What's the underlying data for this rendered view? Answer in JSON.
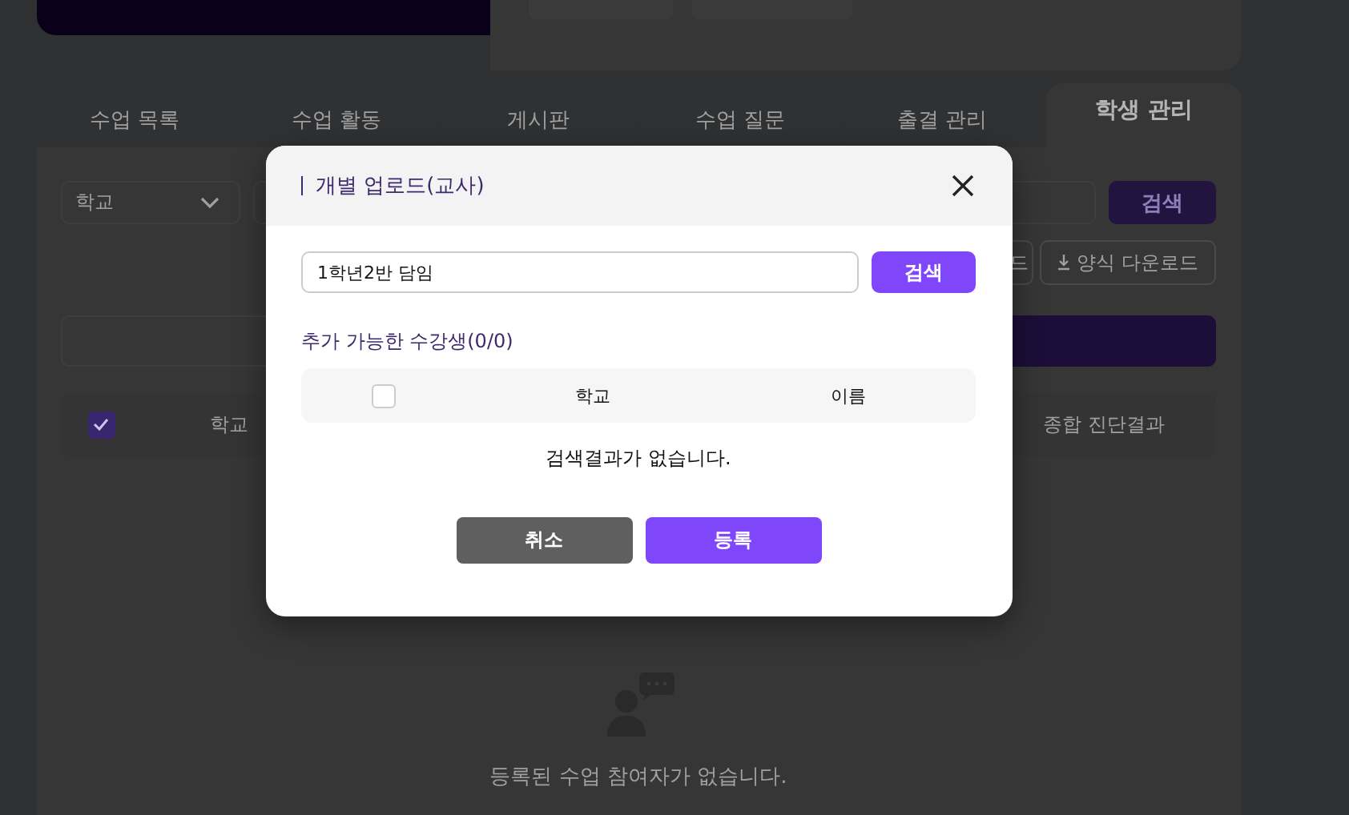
{
  "tabs": [
    {
      "label": "수업 목록",
      "selected": false
    },
    {
      "label": "수업 활동",
      "selected": false
    },
    {
      "label": "게시판",
      "selected": false
    },
    {
      "label": "수업 질문",
      "selected": false
    },
    {
      "label": "출결 관리",
      "selected": false
    },
    {
      "label": "학생 관리",
      "selected": true
    }
  ],
  "filters": {
    "school_select": "학교",
    "search_button": "검색"
  },
  "actions": [
    "드",
    "양식 다운로드"
  ],
  "table": {
    "select_all_checked": true,
    "columns": [
      "학교",
      "종합 진단결과"
    ]
  },
  "empty_message": "등록된 수업 참여자가 없습니다.",
  "dialog": {
    "title": "개별 업로드(교사)",
    "search": {
      "value": "1학년2반 담임",
      "button": "검색"
    },
    "list_label": "추가 가능한 수강생(0/0)",
    "table": {
      "select_all_checked": false,
      "columns": [
        "학교",
        "이름"
      ]
    },
    "empty_message": "검색결과가 없습니다.",
    "buttons": [
      {
        "label": "취소",
        "kind": "secondary"
      },
      {
        "label": "등록",
        "kind": "primary"
      }
    ]
  }
}
